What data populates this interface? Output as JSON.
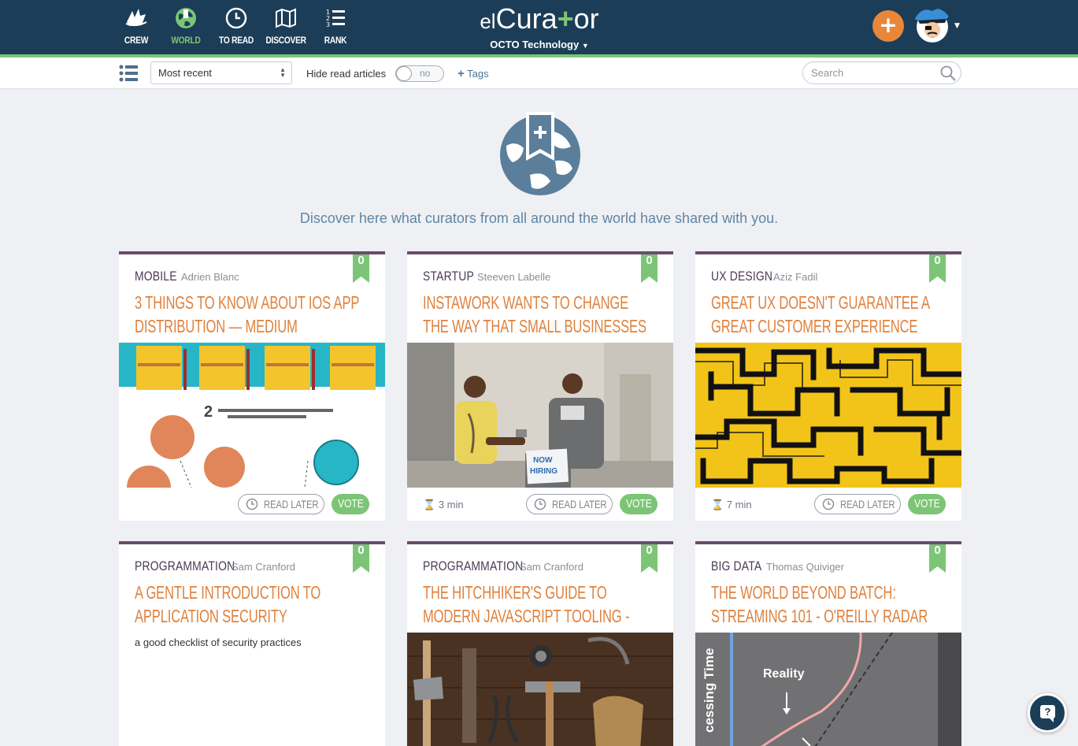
{
  "nav": {
    "items": [
      {
        "label": "CREW",
        "icon": "crew-ship-icon"
      },
      {
        "label": "WORLD",
        "icon": "world-globe-icon",
        "active": true
      },
      {
        "label": "TO READ",
        "icon": "clock-icon"
      },
      {
        "label": "DISCOVER",
        "icon": "map-icon"
      },
      {
        "label": "RANK",
        "icon": "ranked-list-icon"
      }
    ],
    "brand_prefix": "el",
    "brand_part1": "Cura",
    "brand_plus": "+",
    "brand_part2": "or",
    "organization": "OCTO Technology",
    "add_label": "+"
  },
  "toolbar": {
    "sort_value": "Most recent",
    "hide_read_label": "Hide read articles",
    "toggle_text": "no",
    "tags_plus": "+",
    "tags_label": "Tags",
    "search_placeholder": "Search"
  },
  "hero": {
    "text": "Discover here what curators from all around the world have shared with you."
  },
  "cards": [
    {
      "category": "MOBILE",
      "author": "Adrien Blanc",
      "votes": "0",
      "title": "3 things to know about iOS App Distribution — Medium",
      "read_time": "",
      "read_later": "READ LATER",
      "vote": "VOTE",
      "image": "ios-distribution-infographic"
    },
    {
      "category": "STARTUP",
      "author": "Steeven Labelle",
      "votes": "0",
      "title": "Instawork wants to change the way that small businesses hire -...",
      "read_time": "3 min",
      "read_later": "READ LATER",
      "vote": "VOTE",
      "image": "now-hiring-photo"
    },
    {
      "category": "UX DESIGN",
      "author": "Aziz Fadil",
      "votes": "0",
      "title": "Great UX doesn't guarantee a great customer experience",
      "read_time": "7 min",
      "read_later": "READ LATER",
      "vote": "VOTE",
      "image": "yellow-maze-pattern"
    },
    {
      "category": "PROGRAMMATION",
      "author": "Sam Cranford",
      "votes": "0",
      "title": "A Gentle Introduction to Application Security",
      "description": "a good checklist of security practices"
    },
    {
      "category": "PROGRAMMATION",
      "author": "Sam Cranford",
      "votes": "0",
      "title": "The Hitchhiker's guide to Modern JavaScript Tooling - React Kung Fu",
      "image": "tools-on-wood-photo"
    },
    {
      "category": "BIG DATA",
      "author": "Thomas Quiviger",
      "votes": "0",
      "title": "The world beyond batch: Streaming 101 - O'Reilly Radar",
      "image": "processing-time-chart",
      "image_text_1": "Reality",
      "image_text_2": "cessing Time"
    }
  ],
  "help": {
    "label": "?"
  },
  "colors": {
    "navbar": "#1c3d57",
    "accent_green": "#7cc576",
    "title_orange": "#e0813c",
    "category_purple": "#4c3a56",
    "card_border": "#6c4b6c"
  }
}
